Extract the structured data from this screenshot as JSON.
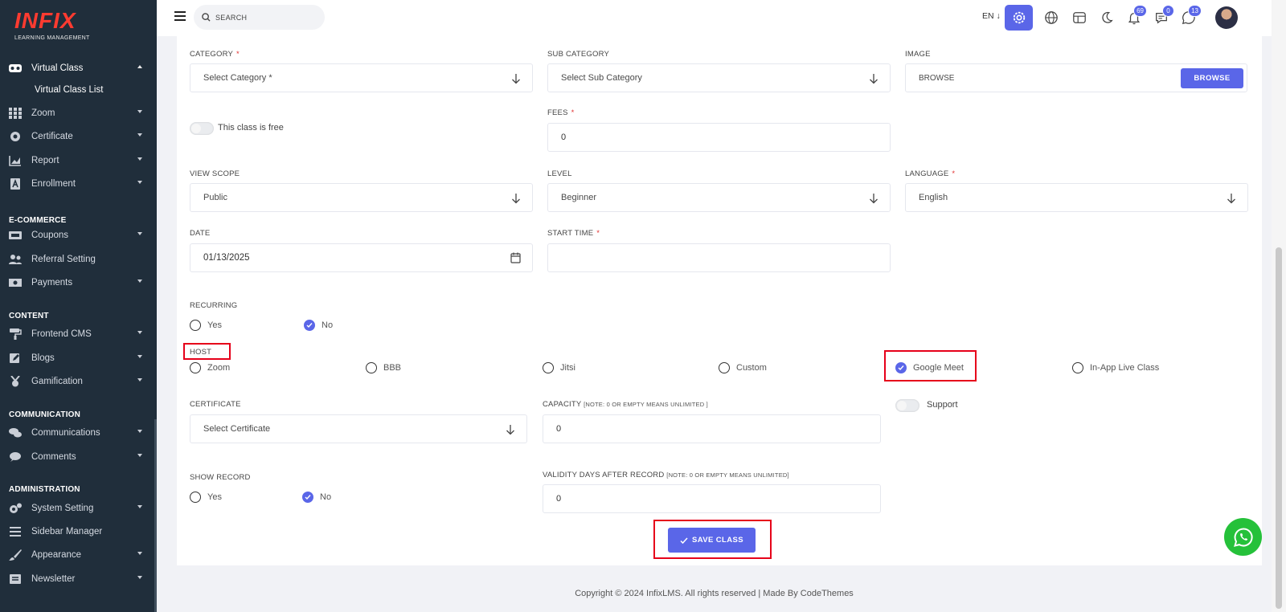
{
  "brand": {
    "logo": "INFIX",
    "sub": "LEARNING MANAGEMENT",
    "logo_color": "#ff3b30"
  },
  "sidebar": {
    "items": [
      {
        "label": "Virtual Class",
        "icon": "vr-headset-icon"
      },
      {
        "label": "Virtual Class List"
      },
      {
        "label": "Zoom",
        "icon": "grid-icon"
      },
      {
        "label": "Certificate",
        "icon": "certificate-icon"
      },
      {
        "label": "Report",
        "icon": "chart-icon"
      },
      {
        "label": "Enrollment",
        "icon": "enrollment-icon"
      },
      {
        "label": "Coupons",
        "icon": "ticket-icon"
      },
      {
        "label": "Referral Setting",
        "icon": "users-icon"
      },
      {
        "label": "Payments",
        "icon": "money-icon"
      },
      {
        "label": "Frontend CMS",
        "icon": "paint-roller-icon"
      },
      {
        "label": "Blogs",
        "icon": "edit-icon"
      },
      {
        "label": "Gamification",
        "icon": "medal-icon"
      },
      {
        "label": "Communications",
        "icon": "comments-icon"
      },
      {
        "label": "Comments",
        "icon": "comment-icon"
      },
      {
        "label": "System Setting",
        "icon": "gears-icon"
      },
      {
        "label": "Sidebar Manager",
        "icon": "bars-icon"
      },
      {
        "label": "Appearance",
        "icon": "brush-icon"
      },
      {
        "label": "Newsletter",
        "icon": "envelope-icon"
      }
    ],
    "sections": [
      "E-COMMERCE",
      "CONTENT",
      "COMMUNICATION",
      "ADMINISTRATION"
    ]
  },
  "topbar": {
    "search_placeholder": "SEARCH",
    "language": "EN",
    "notifications": "69",
    "messages": "0",
    "chats": "13"
  },
  "form": {
    "category": {
      "label": "CATEGORY",
      "value": "Select Category *"
    },
    "sub_category": {
      "label": "SUB CATEGORY",
      "value": "Select Sub Category"
    },
    "image": {
      "label": "IMAGE",
      "value": "BROWSE",
      "button": "BROWSE"
    },
    "free_toggle": "This class is free",
    "fees": {
      "label": "FEES",
      "value": "0"
    },
    "view_scope": {
      "label": "VIEW SCOPE",
      "value": "Public"
    },
    "level": {
      "label": "LEVEL",
      "value": "Beginner"
    },
    "language": {
      "label": "LANGUAGE",
      "value": "English"
    },
    "date": {
      "label": "DATE",
      "value": "01/13/2025"
    },
    "start_time": {
      "label": "START TIME",
      "value": ""
    },
    "recurring": {
      "label": "RECURRING",
      "yes": "Yes",
      "no": "No",
      "selected": "No"
    },
    "host": {
      "label": "HOST",
      "options": [
        "Zoom",
        "BBB",
        "Jitsi",
        "Custom",
        "Google Meet",
        "In-App Live Class"
      ],
      "selected": "Google Meet"
    },
    "certificate": {
      "label": "CERTIFICATE",
      "value": "Select Certificate"
    },
    "capacity": {
      "label": "CAPACITY",
      "note": "[NOTE: 0 OR EMPTY MEANS UNLIMITED ]",
      "value": "0"
    },
    "support": "Support",
    "show_record": {
      "label": "SHOW RECORD",
      "yes": "Yes",
      "no": "No",
      "selected": "No"
    },
    "validity": {
      "label": "VALIDITY DAYS AFTER RECORD",
      "note": "[NOTE: 0 OR EMPTY MEANS UNLIMITED]",
      "value": "0"
    },
    "save": "SAVE CLASS",
    "required_mark": "*"
  },
  "footer": "Copyright © 2024 InfixLMS. All rights reserved | Made By CodeThemes",
  "colors": {
    "primary": "#5a66e8",
    "sidebar": "#202e3b",
    "highlight": "#e6001a",
    "whatsapp": "#25c13a"
  }
}
